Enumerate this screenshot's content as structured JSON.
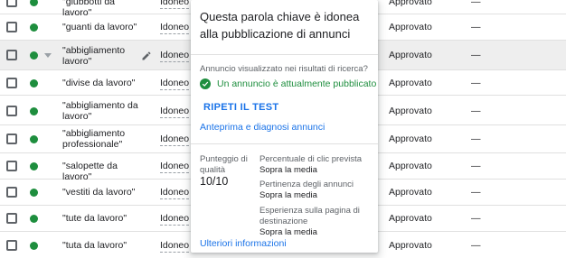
{
  "rows": [
    {
      "keyword": "\"giubbotti da lavoro\"",
      "eligibility": "Idoneo",
      "status": "Approvato",
      "extra": "—"
    },
    {
      "keyword": "\"guanti da lavoro\"",
      "eligibility": "Idoneo",
      "status": "Approvato",
      "extra": "—"
    },
    {
      "keyword": "\"abbigliamento lavoro\"",
      "eligibility": "Idoneo",
      "status": "Approvato",
      "extra": "—"
    },
    {
      "keyword": "\"divise da lavoro\"",
      "eligibility": "Idoneo",
      "status": "Approvato",
      "extra": "—"
    },
    {
      "keyword": "\"abbigliamento da lavoro\"",
      "eligibility": "Idoneo",
      "status": "Approvato",
      "extra": "—"
    },
    {
      "keyword": "\"abbigliamento professionale\"",
      "eligibility": "Idoneo",
      "status": "Approvato",
      "extra": "—"
    },
    {
      "keyword": "\"salopette da lavoro\"",
      "eligibility": "Idoneo",
      "status": "Approvato",
      "extra": "—"
    },
    {
      "keyword": "\"vestiti da lavoro\"",
      "eligibility": "Idoneo",
      "status": "Approvato",
      "extra": "—"
    },
    {
      "keyword": "\"tute da lavoro\"",
      "eligibility": "Idoneo",
      "status": "Approvato",
      "extra": "—"
    },
    {
      "keyword": "\"tuta da lavoro\"",
      "eligibility": "Idoneo",
      "status": "Approvato",
      "extra": "—"
    }
  ],
  "popup": {
    "title": "Questa parola chiave è idonea alla pubblicazione di annunci",
    "question": "Annuncio visualizzato nei risultati di ricerca?",
    "published": "Un annuncio è attualmente pubblicato",
    "retest": "RIPETI IL TEST",
    "preview": "Anteprima e diagnosi annunci",
    "quality_label": "Punteggio di qualità",
    "quality_value": "10/10",
    "ctr_label": "Percentuale di clic prevista",
    "ctr_value": "Sopra la media",
    "relevance_label": "Pertinenza degli annunci",
    "relevance_value": "Sopra la media",
    "landing_label": "Esperienza sulla pagina di destinazione",
    "landing_value": "Sopra la media",
    "more_info": "Ulteriori informazioni"
  },
  "colors": {
    "accent": "#1a73e8",
    "success": "#1e8e3e",
    "icons": [
      "checkbox-icon",
      "status-dot-icon",
      "dropdown-arrow-icon",
      "pencil-icon",
      "check-circle-icon"
    ]
  }
}
